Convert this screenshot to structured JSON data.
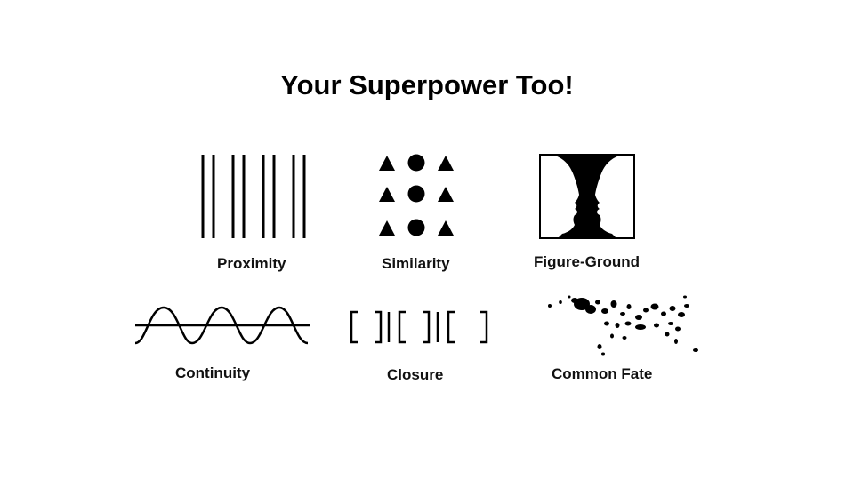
{
  "slide": {
    "title": "Your Superpower Too!",
    "principles": [
      {
        "label": "Proximity",
        "icon": "proximity-lines-icon"
      },
      {
        "label": "Similarity",
        "icon": "similarity-shapes-icon"
      },
      {
        "label": "Figure-Ground",
        "icon": "vase-faces-icon"
      },
      {
        "label": "Continuity",
        "icon": "continuity-curves-icon"
      },
      {
        "label": "Closure",
        "icon": "closure-brackets-icon"
      },
      {
        "label": "Common Fate",
        "icon": "dalmatian-dog-icon"
      }
    ]
  },
  "colors": {
    "background": "#ffffff",
    "ink": "#000000"
  }
}
